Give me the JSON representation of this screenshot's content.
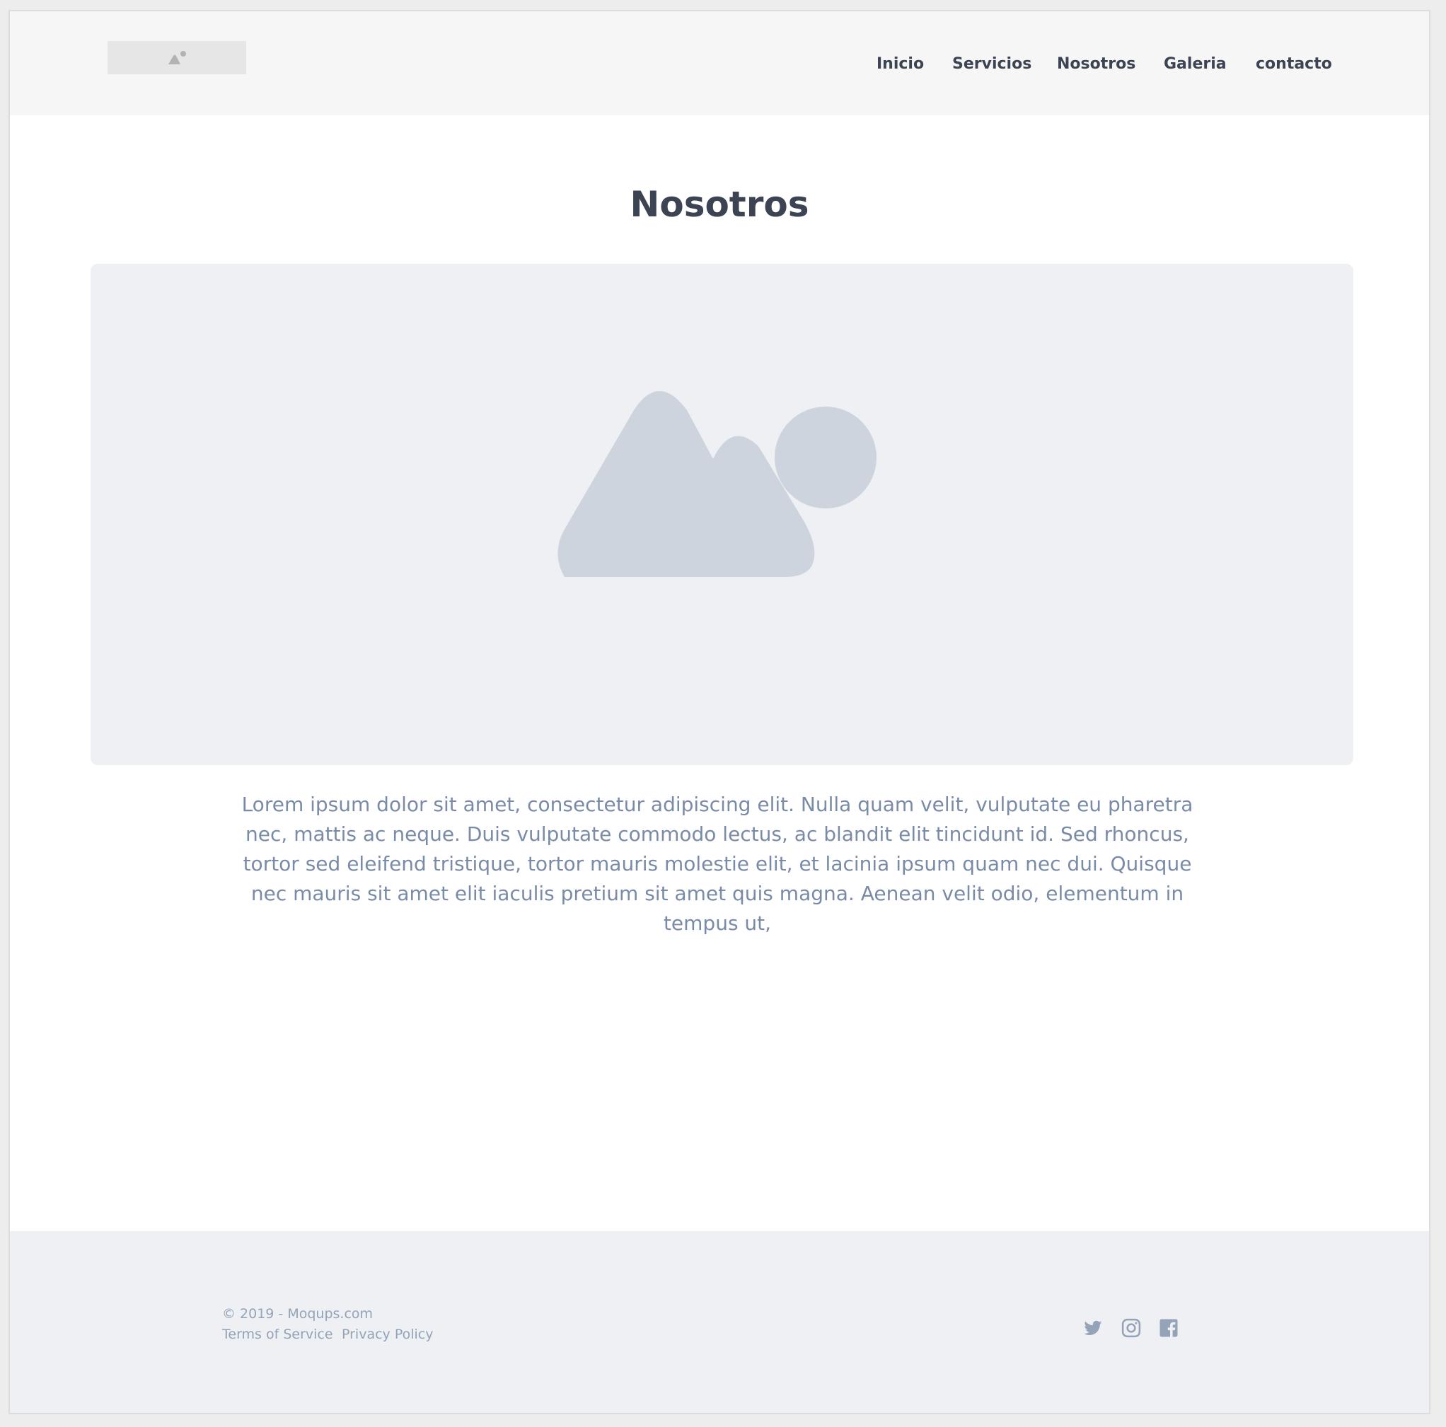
{
  "header": {
    "logo_alt": "logo image placeholder",
    "nav": [
      {
        "label": "Inicio"
      },
      {
        "label": "Servicios"
      },
      {
        "label": "Nosotros"
      },
      {
        "label": "Galeria"
      },
      {
        "label": "contacto"
      }
    ]
  },
  "main": {
    "title": "Nosotros",
    "hero_image": "image-placeholder",
    "paragraph": "Lorem ipsum dolor sit amet, consectetur adipiscing elit. Nulla quam velit, vulputate eu pharetra nec, mattis ac neque. Duis vulputate commodo lectus, ac blandit elit tincidunt id. Sed rhoncus, tortor sed eleifend tristique, tortor mauris molestie elit, et lacinia ipsum quam nec dui. Quisque nec mauris sit amet elit iaculis pretium sit amet quis magna. Aenean velit odio, elementum in tempus ut,"
  },
  "footer": {
    "copyright": "© 2019 - Moqups.com",
    "links": [
      {
        "label": "Terms of Service"
      },
      {
        "label": "Privacy Policy"
      }
    ],
    "social_icons": [
      "twitter-icon",
      "instagram-icon",
      "facebook-icon"
    ]
  },
  "colors": {
    "header_bg": "#f6f6f6",
    "footer_bg": "#eef0f3",
    "heading": "#3c4453",
    "body_text": "#7a8ba7",
    "muted": "#94a3b8",
    "placeholder_shape": "#ced4dd"
  }
}
